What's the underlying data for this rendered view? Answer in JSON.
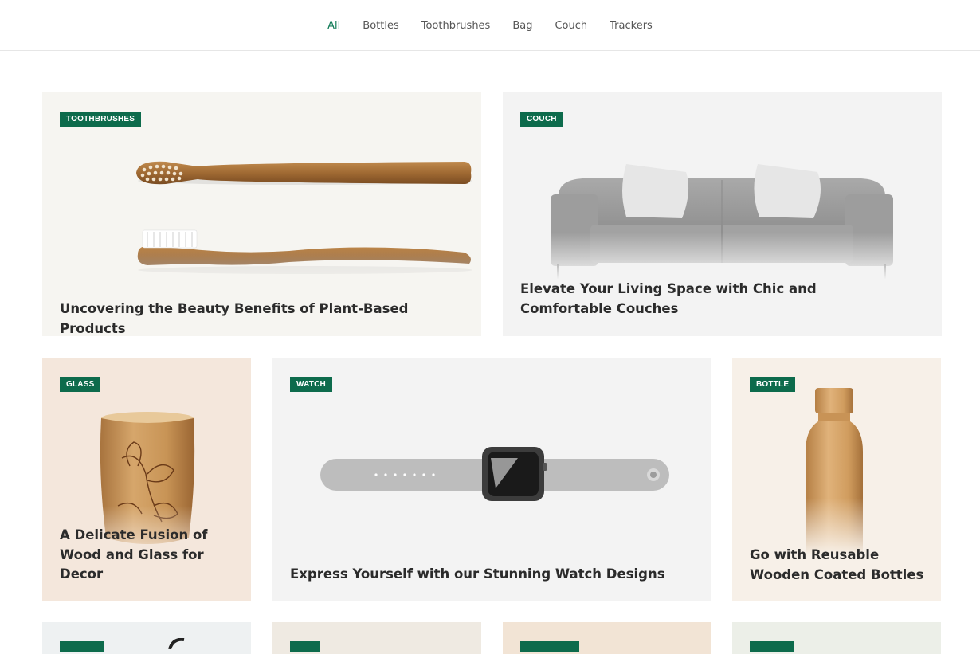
{
  "nav": {
    "items": [
      {
        "label": "All",
        "active": true
      },
      {
        "label": "Bottles",
        "active": false
      },
      {
        "label": "Toothbrushes",
        "active": false
      },
      {
        "label": "Bag",
        "active": false
      },
      {
        "label": "Couch",
        "active": false
      },
      {
        "label": "Trackers",
        "active": false
      }
    ]
  },
  "cards": [
    {
      "badge": "TOOTHBRUSHES",
      "title": "Uncovering the Beauty Benefits of Plant-Based Products",
      "bg": "#f6f5f1",
      "image": "bamboo-toothbrushes"
    },
    {
      "badge": "COUCH",
      "title": "Elevate Your Living Space with Chic and Comfortable Couches",
      "bg": "#f3f3f3",
      "image": "grey-sofa"
    },
    {
      "badge": "GLASS",
      "title": "A Delicate Fusion of Wood and Glass for Decor",
      "bg": "#f4e7dc",
      "image": "bamboo-cup"
    },
    {
      "badge": "WATCH",
      "title": "Express Yourself with our Stunning Watch Designs",
      "bg": "#f3f3f3",
      "image": "smart-watch"
    },
    {
      "badge": "BOTTLE",
      "title": "Go with Reusable Wooden Coated Bottles",
      "bg": "#f7f0e8",
      "image": "wooden-bottle"
    }
  ],
  "partial_cards": [
    {
      "bg": "#eef1f2",
      "badge_color": "#0d6b4c"
    },
    {
      "bg": "#efeae2",
      "badge_color": "#0d6b4c"
    },
    {
      "bg": "#f2e4d5",
      "badge_color": "#0d6b4c"
    },
    {
      "bg": "#ecefe8",
      "badge_color": "#0d6b4c"
    }
  ],
  "colors": {
    "accent": "#0d6b4c",
    "nav_active": "#0e7a55",
    "title": "#2b2b2b"
  }
}
